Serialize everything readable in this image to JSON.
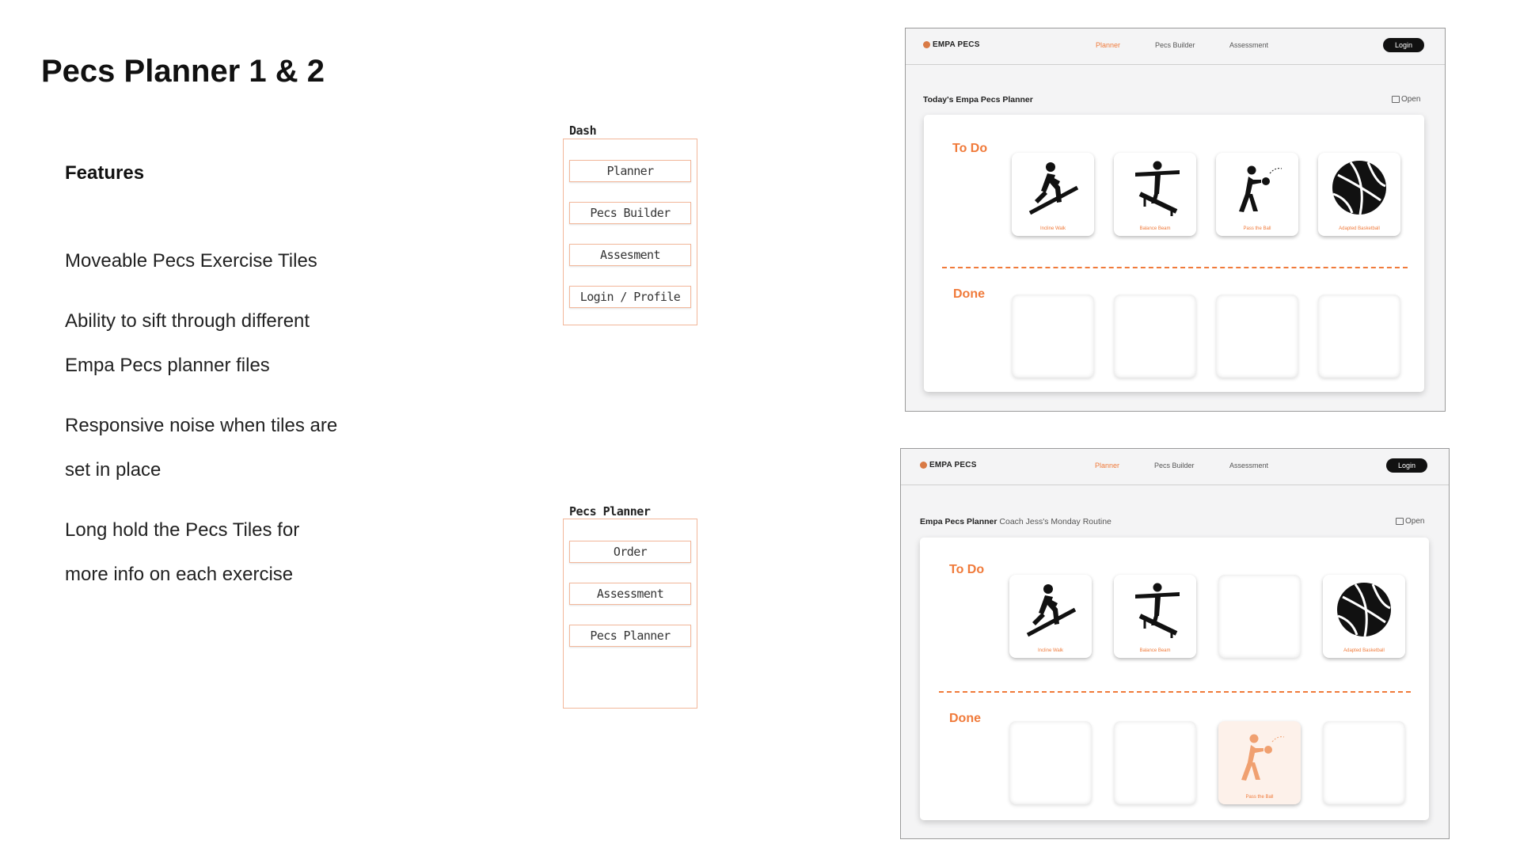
{
  "title": "Pecs Planner 1 & 2",
  "features": {
    "heading": "Features",
    "lines": [
      "Moveable Pecs Exercise Tiles",
      "Ability to sift through different",
      "Empa Pecs planner files",
      "Responsive noise when tiles are",
      "set in place",
      "Long hold the Pecs Tiles for",
      "more info on each exercise"
    ]
  },
  "wireframes": {
    "dash": {
      "label": "Dash",
      "buttons": [
        "Planner",
        "Pecs Builder",
        "Assesment",
        "Login / Profile"
      ]
    },
    "pecs_planner": {
      "label": "Pecs Planner",
      "buttons": [
        "Order",
        "Assessment",
        "Pecs Planner"
      ]
    }
  },
  "app": {
    "brand": "EMPA PECS",
    "nav": [
      "Planner",
      "Pecs Builder",
      "Assessment"
    ],
    "login": "Login",
    "open": "Open",
    "todo_label": "To Do",
    "done_label": "Done",
    "accent": "#f07a3a"
  },
  "mockup1": {
    "title": "Today's Empa Pecs Planner",
    "todo_tiles": [
      {
        "caption": "Incline Walk",
        "icon": "incline-walk-icon"
      },
      {
        "caption": "Balance Beam",
        "icon": "balance-beam-icon"
      },
      {
        "caption": "Pass the Ball",
        "icon": "pass-ball-icon"
      },
      {
        "caption": "Adapted Basketball",
        "icon": "basketball-icon"
      }
    ]
  },
  "mockup2": {
    "title_bold": "Empa Pecs Planner",
    "title_rest": "Coach Jess's Monday Routine",
    "todo_tiles": [
      {
        "caption": "Incline Walk",
        "icon": "incline-walk-icon"
      },
      {
        "caption": "Balance Beam",
        "icon": "balance-beam-icon"
      },
      {
        "caption": "Adapted Basketball",
        "icon": "basketball-icon"
      }
    ],
    "done_tile": {
      "caption": "Pass the Ball",
      "icon": "pass-ball-icon"
    }
  }
}
